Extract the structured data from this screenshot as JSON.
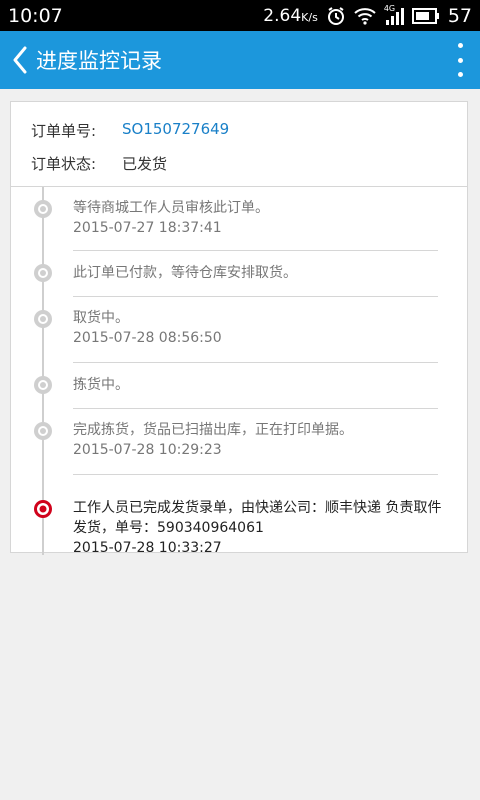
{
  "statusbar": {
    "time": "10:07",
    "data_rate": "2.64",
    "data_unit": "K/s",
    "battery": "57",
    "network": "4G"
  },
  "appbar": {
    "title": "进度监控记录"
  },
  "order": {
    "number_label": "订单单号:",
    "number_value": "SO150727649",
    "status_label": "订单状态:",
    "status_value": "已发货"
  },
  "timeline": [
    {
      "text": "等待商城工作人员审核此订单。",
      "time": "2015-07-27 18:37:41"
    },
    {
      "text": "此订单已付款，等待仓库安排取货。",
      "time": ""
    },
    {
      "text": "取货中。",
      "time": "2015-07-28 08:56:50"
    },
    {
      "text": "拣货中。",
      "time": ""
    },
    {
      "text": "完成拣货，货品已扫描出库，正在打印单据。",
      "time": "2015-07-28 10:29:23"
    },
    {
      "text": "工作人员已完成发货录单，由快递公司：顺丰快递 负责取件发货，单号：590340964061",
      "time": "2015-07-28 10:33:27"
    }
  ],
  "colors": {
    "appbar": "#1c97dc",
    "link": "#1a80c8",
    "active_marker": "#d0021b"
  }
}
